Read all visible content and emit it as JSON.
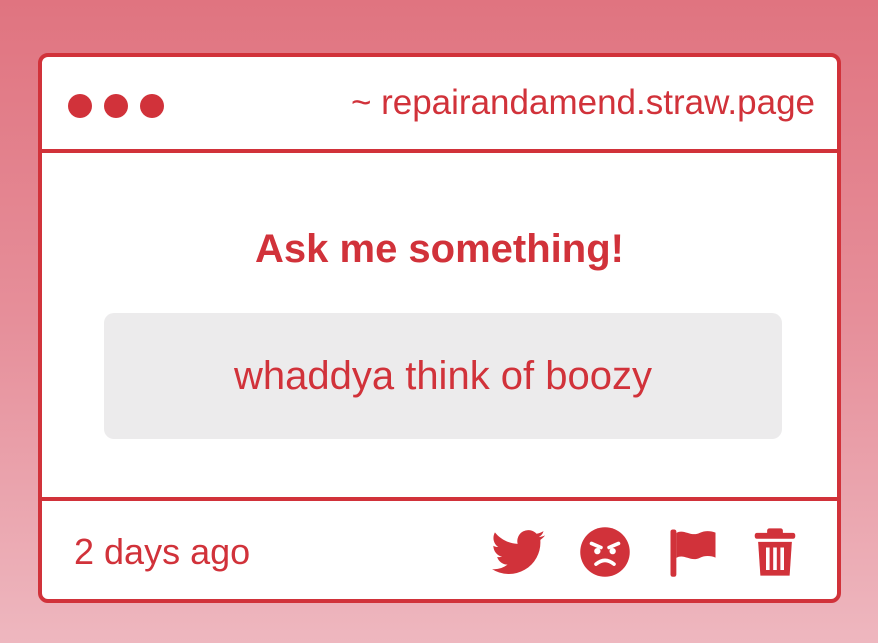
{
  "window": {
    "url": "~ repairandamend.straw.page"
  },
  "content": {
    "heading": "Ask me something!",
    "question": "whaddya think of boozy"
  },
  "footer": {
    "timestamp": "2 days ago",
    "actions": [
      {
        "icon": "twitter-bird-icon"
      },
      {
        "icon": "angry-face-icon"
      },
      {
        "icon": "flag-icon"
      },
      {
        "icon": "trash-icon"
      }
    ]
  },
  "colors": {
    "accent": "#d1323a",
    "card_background": "#ffffff",
    "question_background": "#ecebec",
    "page_gradient_top": "#e07480",
    "page_gradient_bottom": "#eeb7bf"
  }
}
